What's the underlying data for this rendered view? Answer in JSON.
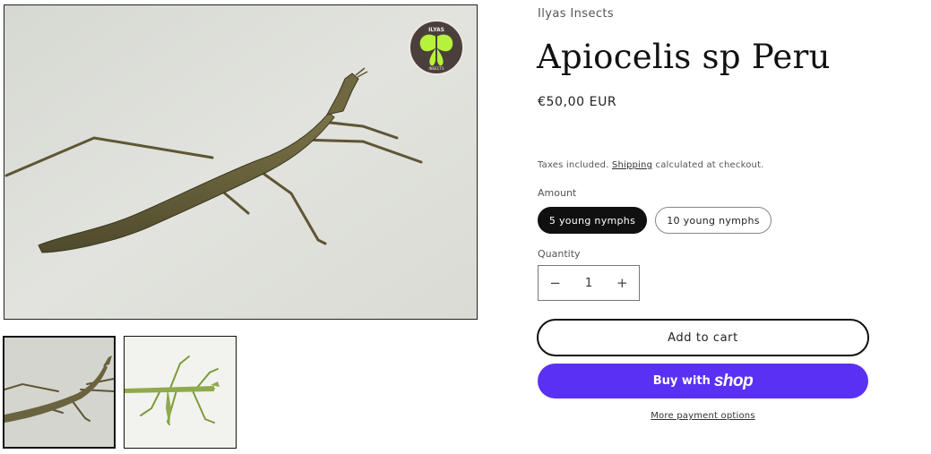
{
  "vendor": "Ilyas Insects",
  "product": {
    "title": "Apiocelis sp Peru",
    "price": "€50,00 EUR"
  },
  "tax": {
    "prefix": "Taxes included.",
    "shipping_link": "Shipping",
    "suffix": "calculated at checkout."
  },
  "amount": {
    "label": "Amount",
    "options": [
      "5 young nymphs",
      "10 young nymphs"
    ],
    "selected": "5 young nymphs"
  },
  "quantity": {
    "label": "Quantity",
    "value": "1",
    "decrement": "−",
    "increment": "+"
  },
  "buttons": {
    "add_to_cart": "Add to cart",
    "buy_with": "Buy with",
    "shop_logo": "shop",
    "more_payment": "More payment options"
  },
  "logo": {
    "top_text": "ILYAS",
    "bottom_text": "INSECTS"
  },
  "colors": {
    "shop_pay": "#5a31f4",
    "selected_pill": "#101010",
    "logo_moth": "#b6f23a"
  },
  "icons": {
    "logo": "luna-moth-logo",
    "minus": "minus-icon",
    "plus": "plus-icon"
  }
}
